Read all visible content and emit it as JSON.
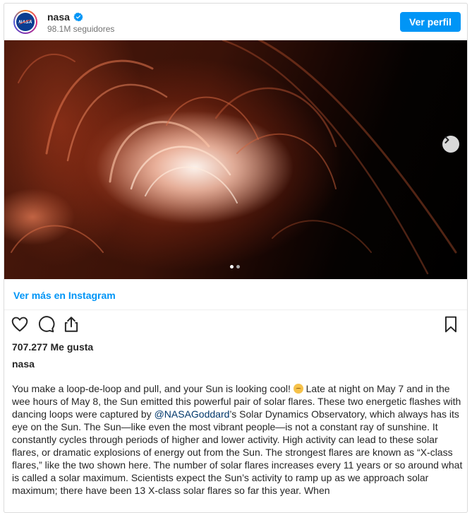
{
  "header": {
    "username": "nasa",
    "followers": "98.1M seguidores",
    "profile_button": "Ver perfil",
    "avatar_text": "NASA",
    "verified_icon": "verified-badge-icon"
  },
  "media": {
    "carousel_index": 1,
    "carousel_total": 2,
    "next_icon": "chevron-right-icon"
  },
  "see_more": "Ver más en Instagram",
  "actions": {
    "like_icon": "heart-icon",
    "comment_icon": "comment-icon",
    "share_icon": "share-icon",
    "save_icon": "bookmark-icon"
  },
  "likes": "707.277 Me gusta",
  "caption": {
    "username": "nasa",
    "text_before_emoji": "You make a loop-de-loop and pull, and your Sun is looking cool! ",
    "text_after_emoji": " Late at night on May 7 and in the wee hours of May 8, the Sun emitted this powerful pair of solar flares. These two energetic flashes with dancing loops were captured by ",
    "mention": "@NASAGoddard",
    "text_after_mention": "’s Solar Dynamics Observatory, which always has its eye on the Sun. The Sun—like even the most vibrant people—is not a constant ray of sunshine. It constantly cycles through periods of higher and lower activity. High activity can lead to these solar flares, or dramatic explosions of energy out from the Sun. The strongest flares are known as “X-class flares,” like the two shown here. The number of solar flares increases every 11 years or so around what is called a solar maximum. Scientists expect the Sun’s activity to ramp up as we approach solar maximum; there have been 13 X-class solar flares so far this year. When"
  },
  "colors": {
    "accent": "#0095f6",
    "text": "#262626",
    "muted": "#737373",
    "mention": "#00376b"
  }
}
